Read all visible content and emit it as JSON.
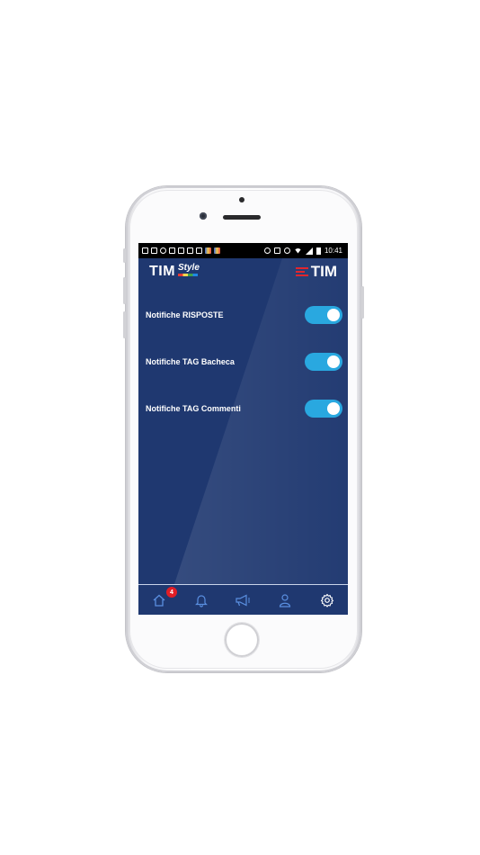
{
  "status_bar": {
    "time": "10:41"
  },
  "header": {
    "brand_left": "TIM",
    "brand_left_sub": "Style",
    "brand_right": "TIM"
  },
  "settings": [
    {
      "label": "Notifiche RISPOSTE",
      "enabled": true
    },
    {
      "label": "Notifiche TAG Bacheca",
      "enabled": true
    },
    {
      "label": "Notifiche TAG Commenti",
      "enabled": true
    }
  ],
  "tabbar": {
    "home_badge": "4",
    "items": [
      "home-icon",
      "bell-icon",
      "megaphone-icon",
      "user-icon",
      "gear-icon"
    ],
    "active": "gear-icon"
  },
  "colors": {
    "screen_bg": "#1f3870",
    "toggle_on": "#29a8e0",
    "badge": "#e21e26",
    "brand_red": "#e1262d",
    "tab_icon": "#5a8fe0",
    "tab_icon_active": "#ffffff"
  }
}
